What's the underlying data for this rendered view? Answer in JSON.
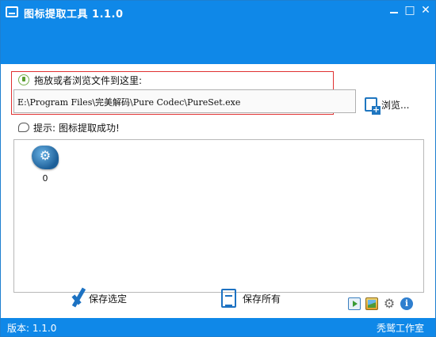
{
  "window": {
    "title": "图标提取工具 1.1.0",
    "controls": {
      "minimize": "—",
      "maximize": "□",
      "close": "✕"
    }
  },
  "drop_area": {
    "label": "拖放或者浏览文件到这里:",
    "file_path": "E:\\Program Files\\完美解码\\Pure Codec\\PureSet.exe",
    "browse_label": "浏览..."
  },
  "hint": {
    "label": "提示:",
    "text": "图标提取成功!"
  },
  "icon_list": [
    {
      "caption": "0",
      "icon": "gear-app-icon"
    }
  ],
  "actions": {
    "save_selected": "保存选定",
    "save_all": "保存所有"
  },
  "tools": {
    "gear_glyph": "⚙",
    "info_glyph": "i"
  },
  "status": {
    "version": "版本: 1.1.0",
    "author": "秃鹫工作室"
  },
  "colors": {
    "title_bar": "#0f88e8",
    "highlight_border": "#e03030",
    "accent_icon": "#1d72c2"
  }
}
